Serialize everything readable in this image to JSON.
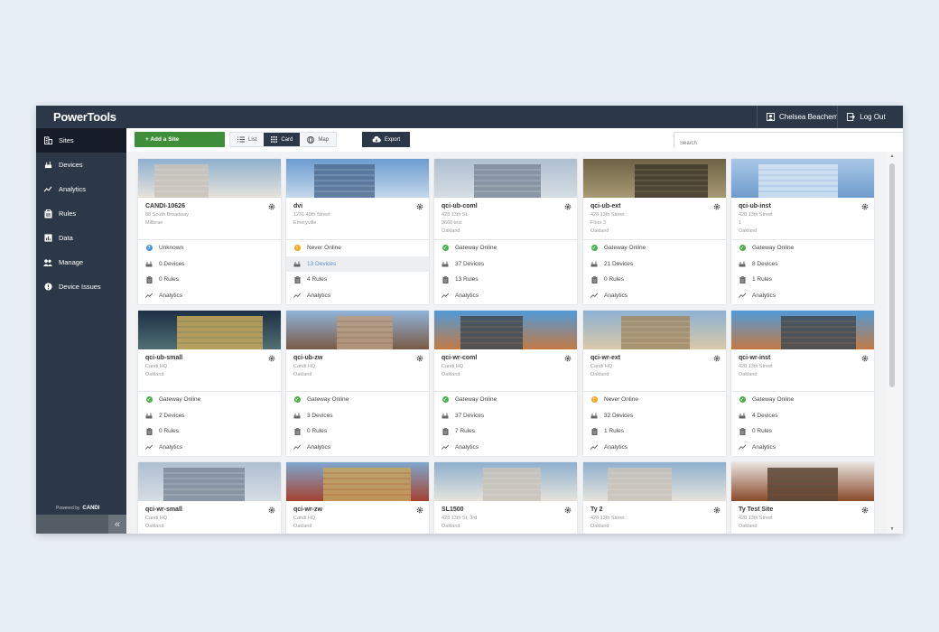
{
  "app_title": "PowerTools",
  "user": {
    "name": "Chelsea Beachem",
    "logout_label": "Log Out"
  },
  "sidebar": {
    "items": [
      {
        "label": "Sites",
        "icon": "building-icon"
      },
      {
        "label": "Devices",
        "icon": "device-icon"
      },
      {
        "label": "Analytics",
        "icon": "trend-icon"
      },
      {
        "label": "Rules",
        "icon": "clipboard-icon"
      },
      {
        "label": "Data",
        "icon": "chart-icon"
      },
      {
        "label": "Manage",
        "icon": "users-icon"
      },
      {
        "label": "Device Issues",
        "icon": "alert-icon"
      }
    ],
    "powered_by": "Powered by",
    "brand": "CANDI",
    "collapse_glyph": "«"
  },
  "toolbar": {
    "add_label": "+ Add a Site",
    "list_label": "List",
    "card_label": "Card",
    "map_label": "Map",
    "export_label": "Export",
    "search_placeholder": "Search"
  },
  "colors": {
    "online": "#4caf50",
    "never": "#f5a623",
    "unknown": "#4a90d9",
    "sidebar": "#2c3748",
    "accent_green": "#3f8f3a"
  },
  "cards": [
    {
      "name": "CANDI-10626",
      "addr": [
        "88 South Broadway",
        "Millbrae"
      ],
      "status": "Unknown",
      "status_type": "unknown",
      "devices": "0 Devices",
      "rules": "0 Rules",
      "analytics": "Analytics",
      "img": [
        "#8fb0cf",
        "#e6e3dc",
        "#c9c3b8"
      ]
    },
    {
      "name": "dvi",
      "addr": [
        "1231 40th Street",
        "Emeryville"
      ],
      "status": "Never Online",
      "status_type": "never",
      "devices": "13 Devices",
      "rules": "4 Rules",
      "analytics": "Analytics",
      "img": [
        "#6c9cd0",
        "#c4d7ea",
        "#4f6f92"
      ],
      "highlight": true
    },
    {
      "name": "qci-ub-coml",
      "addr": [
        "428 13th St.",
        "9660 test",
        "Oakland"
      ],
      "status": "Gateway Online",
      "status_type": "online",
      "devices": "37 Devices",
      "rules": "13 Rules",
      "analytics": "Analytics",
      "img": [
        "#aebfd0",
        "#d6dde4",
        "#7c8a99"
      ]
    },
    {
      "name": "qci-ub-ext",
      "addr": [
        "428 13th Street",
        "Floor 3",
        "Oakland"
      ],
      "status": "Gateway Online",
      "status_type": "online",
      "devices": "21 Devices",
      "rules": "0 Rules",
      "analytics": "Analytics",
      "img": [
        "#6e6245",
        "#a79a73",
        "#3f3a2c"
      ]
    },
    {
      "name": "qci-ub-inst",
      "addr": [
        "428 13th Street",
        "1",
        "Oakland"
      ],
      "status": "Gateway Online",
      "status_type": "online",
      "devices": "8 Devices",
      "rules": "1 Rules",
      "analytics": "Analytics",
      "img": [
        "#a9c7e6",
        "#6f9ccd",
        "#d6e6f4"
      ]
    },
    {
      "name": "qci-ub-small",
      "addr": [
        "Candi HQ",
        "Oakland"
      ],
      "status": "Gateway Online",
      "status_type": "online",
      "devices": "2 Devices",
      "rules": "0 Rules",
      "analytics": "Analytics",
      "img": [
        "#1d3045",
        "#4f6f72",
        "#c8a85a"
      ]
    },
    {
      "name": "qci-ub-zw",
      "addr": [
        "Candi HQ",
        "Oakland"
      ],
      "status": "Gateway Online",
      "status_type": "online",
      "devices": "3 Devices",
      "rules": "0 Rules",
      "analytics": "Analytics",
      "img": [
        "#8fb4db",
        "#7a5a44",
        "#b99c80"
      ]
    },
    {
      "name": "qci-wr-coml",
      "addr": [
        "Candi HQ",
        "Oakland"
      ],
      "status": "Gateway Online",
      "status_type": "online",
      "devices": "37 Devices",
      "rules": "7 Rules",
      "analytics": "Analytics",
      "img": [
        "#4f9ad8",
        "#c47a43",
        "#3f4a55"
      ]
    },
    {
      "name": "qci-wr-ext",
      "addr": [
        "Candi HQ",
        "Oakland"
      ],
      "status": "Never Online",
      "status_type": "never",
      "devices": "32 Devices",
      "rules": "1 Rules",
      "analytics": "Analytics",
      "img": [
        "#8db0d4",
        "#d9c9a9",
        "#a08a66"
      ]
    },
    {
      "name": "qci-wr-inst",
      "addr": [
        "428 13th Street",
        "Oakland"
      ],
      "status": "Gateway Online",
      "status_type": "online",
      "devices": "4 Devices",
      "rules": "0 Rules",
      "analytics": "Analytics",
      "img": [
        "#4f9ad8",
        "#c47a43",
        "#3f4a55"
      ]
    },
    {
      "name": "qci-wr-small",
      "addr": [
        "Candi HQ",
        "Oakland"
      ],
      "status": "",
      "status_type": "",
      "devices": "",
      "rules": "",
      "analytics": "",
      "img": [
        "#aebfd0",
        "#d6dde4",
        "#7c8a99"
      ]
    },
    {
      "name": "qci-wr-zw",
      "addr": [
        "Candi HQ",
        "Oakland"
      ],
      "status": "",
      "status_type": "",
      "devices": "",
      "rules": "",
      "analytics": "",
      "img": [
        "#7fa7cf",
        "#a5422f",
        "#c4a35f"
      ]
    },
    {
      "name": "SL1500",
      "addr": [
        "428 13th St, 3rd",
        "Oakland"
      ],
      "status": "",
      "status_type": "",
      "devices": "",
      "rules": "",
      "analytics": "",
      "img": [
        "#8fb0cf",
        "#e6e3dc",
        "#c9c3b8"
      ]
    },
    {
      "name": "Ty 2",
      "addr": [
        "428 13th Street",
        "Oakland"
      ],
      "status": "",
      "status_type": "",
      "devices": "",
      "rules": "",
      "analytics": "",
      "img": [
        "#8fb0cf",
        "#e6e3dc",
        "#c9c3b8"
      ]
    },
    {
      "name": "Ty Test Site",
      "addr": [
        "428 13th Street",
        "Oakland"
      ],
      "status": "",
      "status_type": "",
      "devices": "",
      "rules": "",
      "analytics": "",
      "img": [
        "#e7e4df",
        "#8a4a2a",
        "#5a4636"
      ]
    }
  ]
}
